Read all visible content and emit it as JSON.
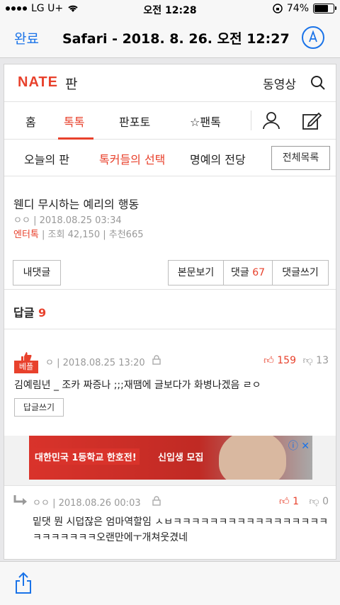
{
  "status": {
    "carrier": "LG U+",
    "time": "오전 12:28",
    "battery": "74%",
    "battery_level": 0.74
  },
  "safari": {
    "done_label": "완료",
    "title": "Safari - 2018. 8. 26. 오전 12:27"
  },
  "nate": {
    "logo": "NATE",
    "logo_sub": "판",
    "video": "동영상"
  },
  "menu": {
    "items": [
      "홈",
      "톡톡",
      "판포토",
      "☆팬톡"
    ],
    "active_index": 1
  },
  "submenu": {
    "items": [
      "오늘의 판",
      "톡커들의 선택",
      "명예의 전당"
    ],
    "active_index": 1,
    "all_button": "전체목록"
  },
  "article": {
    "title": "웬디 무시하는 예리의 행동",
    "author": "ㅇㅇ",
    "date": "2018.08.25 03:34",
    "category": "엔터톡",
    "views": "조회 42,150",
    "recommend": "추천665"
  },
  "buttons": {
    "my_comments": "내댓글",
    "view_body": "본문보기",
    "comments_label": "댓글",
    "comments_count": "67",
    "write_comment": "댓글쓰기"
  },
  "replies": {
    "label": "답글",
    "count": "9"
  },
  "comment1": {
    "badge": "베플",
    "author": "ㅇ",
    "date": "2018.08.25 13:20",
    "up": "159",
    "down": "13",
    "text": "김예림년 _ 조카 짜증나 ;;;재땜에 글보다가 화병나겠음 ㄹㅇ",
    "reply_button": "답글쓰기"
  },
  "ad": {
    "text1": "대한민국 1등학교 한호전!",
    "text2": "신입생 모집",
    "close": "ⓘ ✕"
  },
  "comment2": {
    "author": "ㅇㅇ",
    "date": "2018.08.26 00:03",
    "up": "1",
    "down": "0",
    "text": "밑댓 뭔 시덥잖은 엄마역할임 ㅅㅂㅋㅋㅋㅋㅋㅋㅋㅋㅋㅋㅋㅋㅋㅋㅋㅋㅋㅋㅋㅋㅋㅋㅋㅋ오랜만에ㅜ개쳐웃겼네"
  },
  "colors": {
    "accent": "#e8412c",
    "link": "#1a73e8"
  }
}
